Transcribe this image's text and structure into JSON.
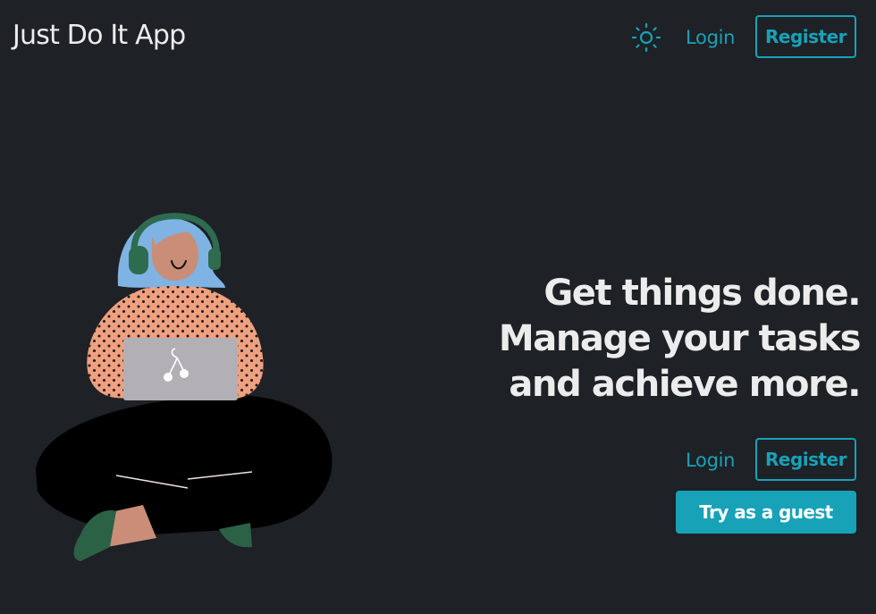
{
  "header": {
    "title": "Just Do It App",
    "theme_toggle_icon": "sun-icon",
    "login_label": "Login",
    "register_label": "Register"
  },
  "hero": {
    "headline_lines": [
      "Get things done.",
      "Manage your tasks",
      "and achieve more."
    ],
    "login_label": "Login",
    "register_label": "Register",
    "guest_label": "Try as a guest"
  },
  "illustration": {
    "subject": "person-with-headphones-and-laptop",
    "laptop_logo_icon": "cherry-icon"
  },
  "colors": {
    "background": "#1e2125",
    "accent": "#17a2b8",
    "text": "#ececec",
    "hair": "#7fb3e3",
    "sweater": "#efa07f",
    "headphones": "#2e6b4f",
    "laptop": "#b3b0b5",
    "pants": "#000000",
    "shoes": "#2b6145"
  }
}
